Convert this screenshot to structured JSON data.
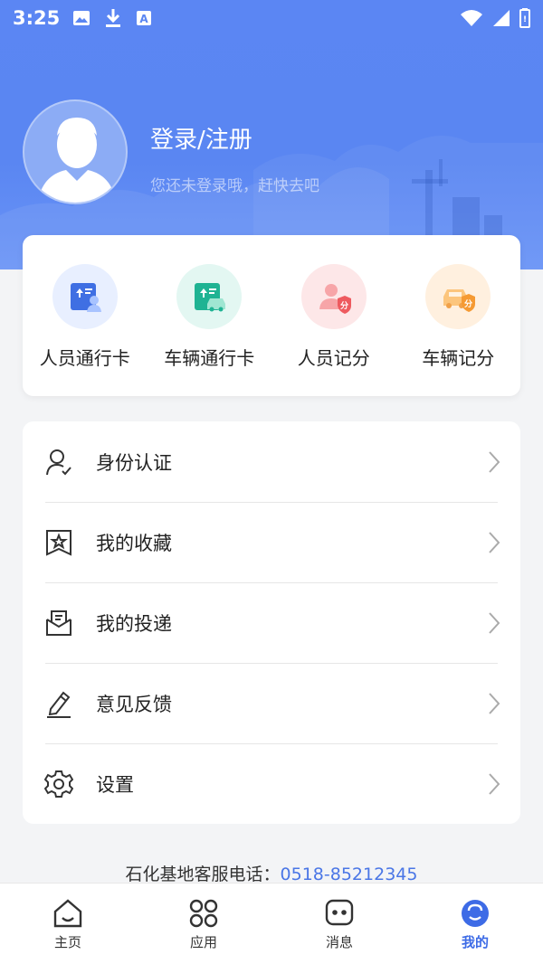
{
  "status_bar": {
    "time": "3:25",
    "left_icons": [
      "image-icon",
      "download-icon",
      "text-a-icon"
    ],
    "right_icons": [
      "wifi-icon",
      "signal-icon",
      "battery-icon"
    ]
  },
  "profile": {
    "title": "登录/注册",
    "subtitle": "您还未登录哦，赶快去吧"
  },
  "quick_actions": [
    {
      "label": "人员通行卡",
      "icon": "person-pass-card-icon",
      "bg": "#e8efff"
    },
    {
      "label": "车辆通行卡",
      "icon": "vehicle-pass-card-icon",
      "bg": "#e3f7f2"
    },
    {
      "label": "人员记分",
      "icon": "person-score-icon",
      "bg": "#fde7e8"
    },
    {
      "label": "车辆记分",
      "icon": "vehicle-score-icon",
      "bg": "#fff0df"
    }
  ],
  "menu": [
    {
      "label": "身份认证",
      "icon": "identity-verify-icon"
    },
    {
      "label": "我的收藏",
      "icon": "favorites-star-icon"
    },
    {
      "label": "我的投递",
      "icon": "delivery-mail-icon"
    },
    {
      "label": "意见反馈",
      "icon": "feedback-edit-icon"
    },
    {
      "label": "设置",
      "icon": "settings-gear-icon"
    }
  ],
  "hotline": {
    "label": "石化基地客服电话：",
    "phone": "0518-85212345"
  },
  "tabs": [
    {
      "label": "主页",
      "icon": "home-icon",
      "active": false
    },
    {
      "label": "应用",
      "icon": "apps-icon",
      "active": false
    },
    {
      "label": "消息",
      "icon": "message-icon",
      "active": false
    },
    {
      "label": "我的",
      "icon": "profile-icon",
      "active": true
    }
  ],
  "colors": {
    "hero_blue": "#5a86f2",
    "accent": "#3d6be6",
    "phone_link": "#4a76e6"
  }
}
